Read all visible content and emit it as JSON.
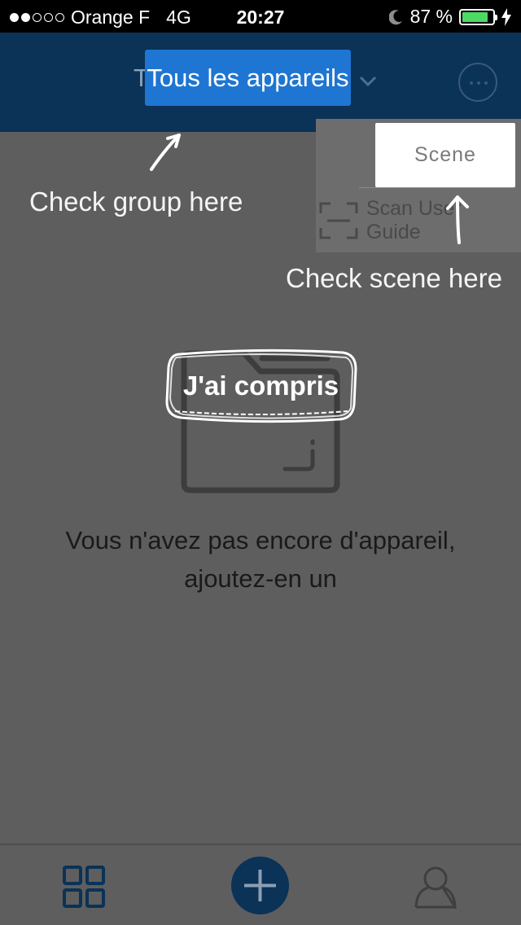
{
  "status_bar": {
    "carrier": "Orange F",
    "network": "4G",
    "time": "20:27",
    "battery": "87 %",
    "battery_level": 0.87,
    "signal_bars": 2,
    "signal_total": 5
  },
  "header": {
    "title": "Tous les appareils",
    "more_icon": "more-icon",
    "chevron_icon": "chevron-down-icon"
  },
  "menu": {
    "scene_label": "Scene",
    "scan_label": "Scan User Guide"
  },
  "tour": {
    "group_hint": "Check group here",
    "scene_hint": "Check scene here",
    "got_it_label": "J'ai compris"
  },
  "empty_state": {
    "line1": "Vous n'avez pas encore d'appareil,",
    "line2": "ajoutez-en un"
  },
  "tabbar": {
    "devices_icon": "grid-icon",
    "add_icon": "plus-icon",
    "profile_icon": "user-icon"
  },
  "colors": {
    "header_bg": "#0b3257",
    "highlight": "#1e76d2",
    "overlay": "#5e5e5e",
    "battery_fill": "#4cd964"
  }
}
